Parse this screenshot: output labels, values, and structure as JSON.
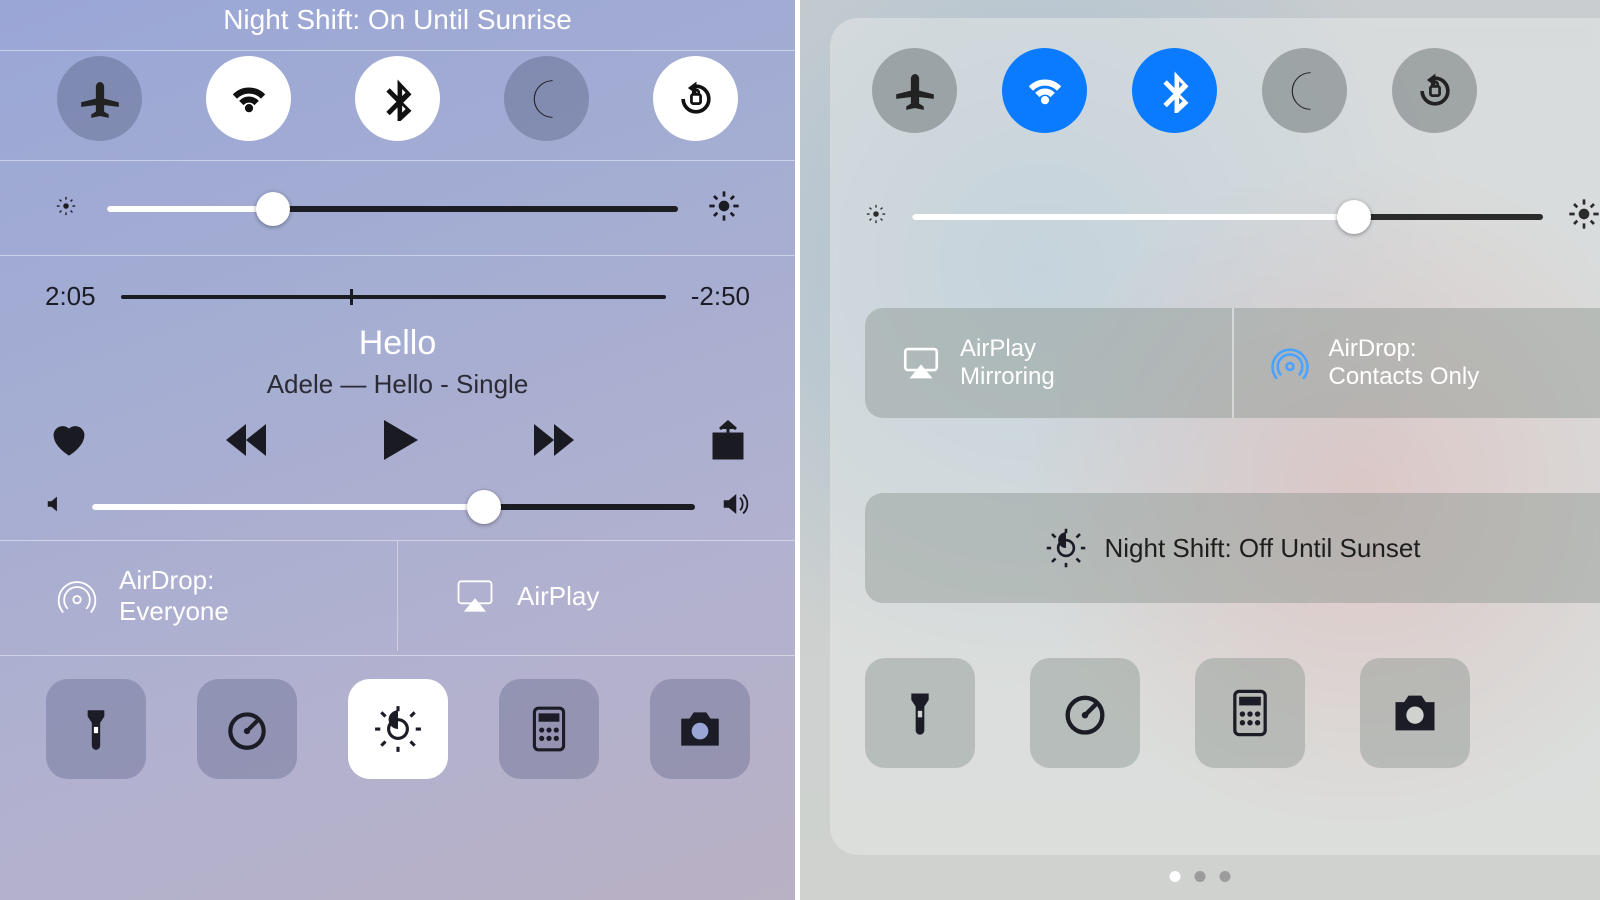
{
  "left": {
    "night_shift_label": "Night Shift: On Until Sunrise",
    "toggles": {
      "airplane": {
        "name": "airplane-mode",
        "on": false
      },
      "wifi": {
        "name": "wifi",
        "on": true
      },
      "bluetooth": {
        "name": "bluetooth",
        "on": true
      },
      "dnd": {
        "name": "do-not-disturb",
        "on": false
      },
      "rotation": {
        "name": "rotation-lock",
        "on": true
      }
    },
    "brightness_pct": 29,
    "media": {
      "elapsed": "2:05",
      "remaining": "-2:50",
      "progress_pct": 42,
      "title": "Hello",
      "subtitle": "Adele — Hello - Single",
      "volume_pct": 65
    },
    "airdrop": {
      "label": "AirDrop:",
      "value": "Everyone"
    },
    "airplay": {
      "label": "AirPlay"
    },
    "utilities": [
      "flashlight",
      "timer",
      "night-shift",
      "calculator",
      "camera"
    ],
    "active_utility": "night-shift"
  },
  "right": {
    "toggles": {
      "airplane": {
        "on": false
      },
      "wifi": {
        "on": true
      },
      "bluetooth": {
        "on": true
      },
      "dnd": {
        "on": false
      },
      "rotation": {
        "on": false
      }
    },
    "brightness_pct": 70,
    "airplay": {
      "label1": "AirPlay",
      "label2": "Mirroring"
    },
    "airdrop": {
      "label1": "AirDrop:",
      "label2": "Contacts Only"
    },
    "night_shift_label": "Night Shift: Off Until Sunset",
    "utilities": [
      "flashlight",
      "timer",
      "calculator",
      "camera"
    ],
    "pager": {
      "count": 3,
      "current": 0
    }
  }
}
